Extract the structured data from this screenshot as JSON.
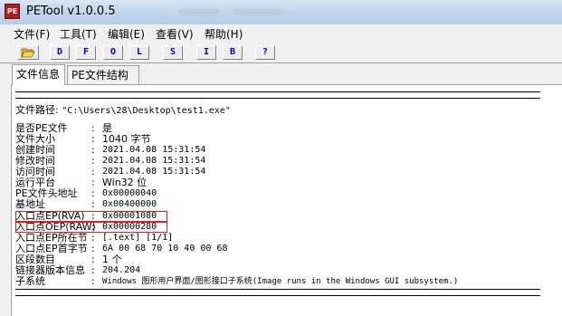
{
  "window": {
    "title": "PETool v1.0.0.5",
    "icon_label": "PE"
  },
  "menu": [
    "文件(F)",
    "工具(T)",
    "编辑(E)",
    "查看(V)",
    "帮助(H)"
  ],
  "toolbar": {
    "open_icon": "folder-open-icon",
    "buttons": [
      "D",
      "F",
      "O",
      "L",
      "S",
      "I",
      "B",
      "?"
    ]
  },
  "tabs": [
    "文件信息",
    "PE文件结构"
  ],
  "info": {
    "path_label": "文件路径:",
    "path_value": "\"C:\\Users\\28\\Desktop\\test1.exe\"",
    "rows": [
      {
        "label": "是否PE文件",
        "value": "是"
      },
      {
        "label": "文件大小",
        "value": "1040 字节"
      },
      {
        "label": "创建时间",
        "value": "2021.04.08 15:31:54"
      },
      {
        "label": "修改时间",
        "value": "2021.04.08 15:31:54"
      },
      {
        "label": "访问时间",
        "value": "2021.04.08 15:31:54"
      },
      {
        "label": "运行平台",
        "value": "Win32 位"
      },
      {
        "label": "PE文件头地址",
        "value": "0x00000040"
      },
      {
        "label": "基地址",
        "value": "0x00400000"
      },
      {
        "label": "入口点EP(RVA)",
        "value": "0x00001080"
      },
      {
        "label": "入口点OEP(RAW)",
        "value": "0x00000280"
      },
      {
        "label": "入口点EP所在节",
        "value": "[.text] [1/1]"
      },
      {
        "label": "入口点EP首字节",
        "value": "6A 00 68 70 10 40 00 68"
      },
      {
        "label": "区段数目",
        "value": "1 个"
      },
      {
        "label": "链接器版本信息",
        "value": "204.204"
      },
      {
        "label": "子系统",
        "value": "Windows 图形用户界面/图形接口子系统(Image runs in the Windows GUI subsystem.)"
      }
    ]
  },
  "colors": {
    "highlight_border": "#e02020",
    "toolbar_letter": "#0000c0"
  }
}
